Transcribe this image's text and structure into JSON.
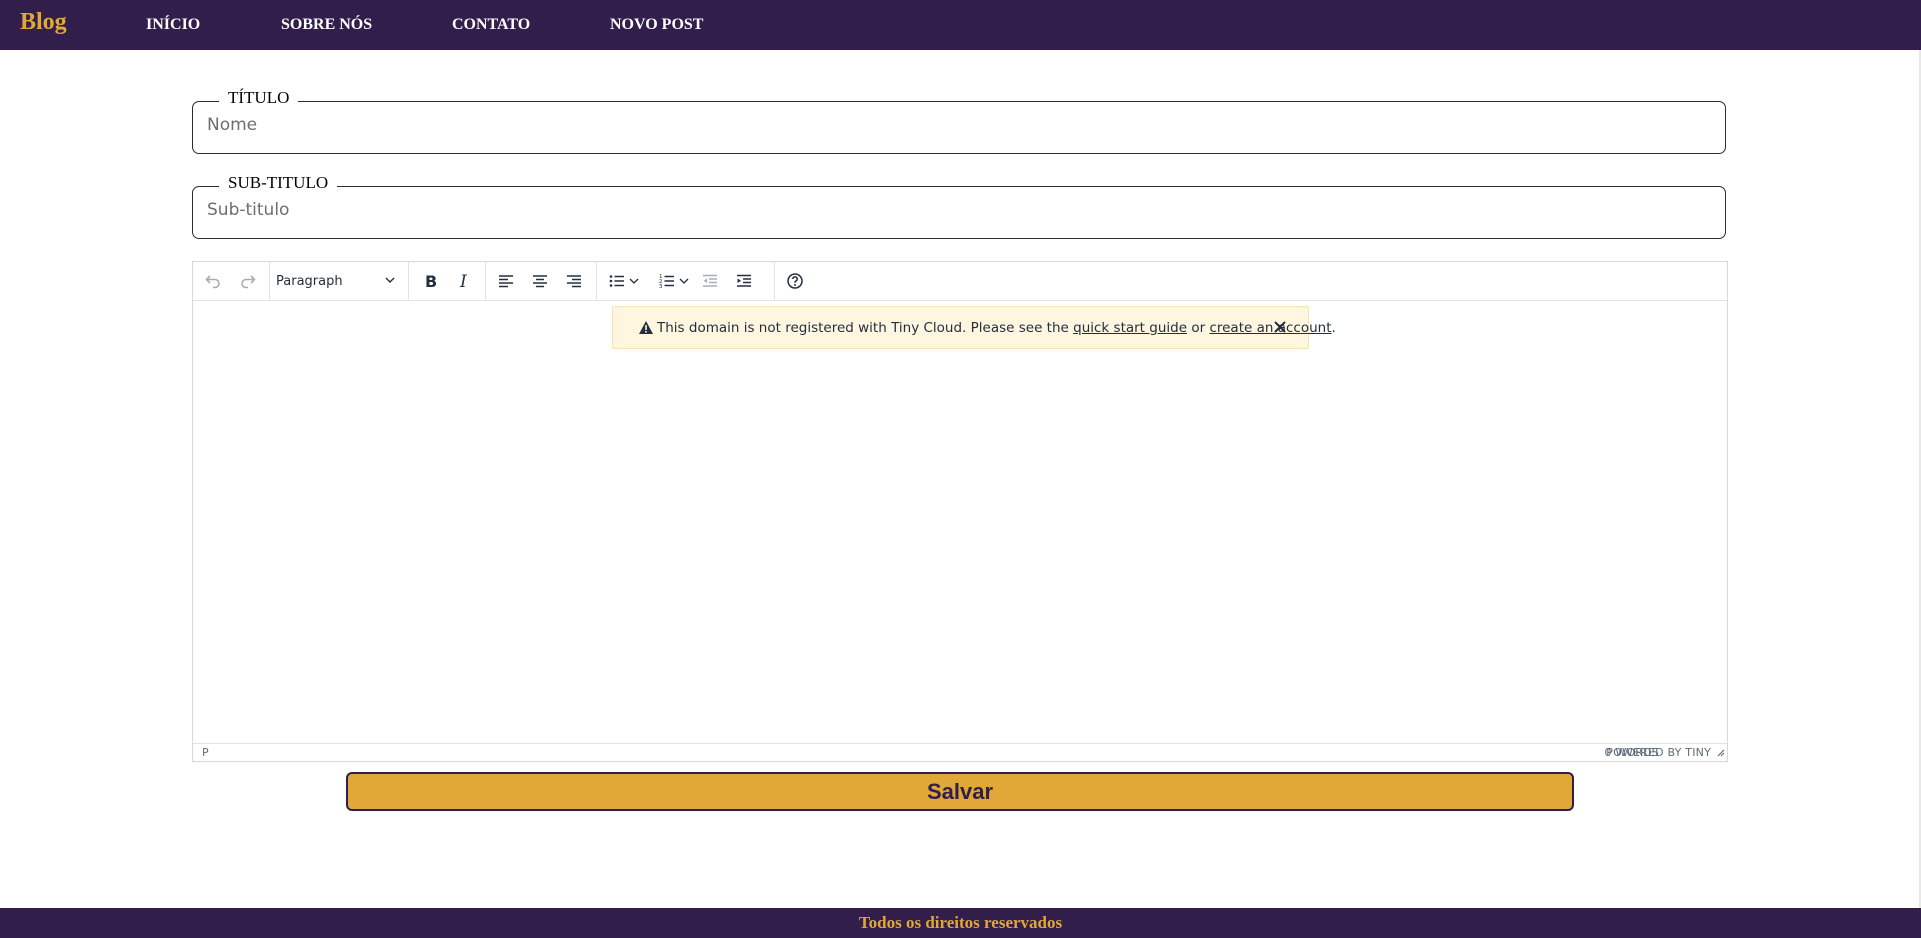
{
  "navbar": {
    "brand": "Blog",
    "links": [
      "INÍCIO",
      "SOBRE NÓS",
      "CONTATO",
      "NOVO POST"
    ]
  },
  "form": {
    "title_legend": "TÍTULO",
    "title_placeholder": "Nome",
    "subtitle_legend": "SUB-TITULO",
    "subtitle_placeholder": "Sub-titulo"
  },
  "editor": {
    "block_format": "Paragraph",
    "notice": {
      "text_before": "This domain is not registered with Tiny Cloud. Please see the ",
      "link1": "quick start guide",
      "text_mid": " or ",
      "link2": "create an account",
      "text_after": "."
    },
    "status_path": "P",
    "word_count": "0 WORDS",
    "powered_by": "POWERED BY TINY"
  },
  "save_button": "Salvar",
  "footer": "Todos os direitos reservados",
  "colors": {
    "brand_purple": "#311e4b",
    "accent_gold": "#e1a737"
  }
}
